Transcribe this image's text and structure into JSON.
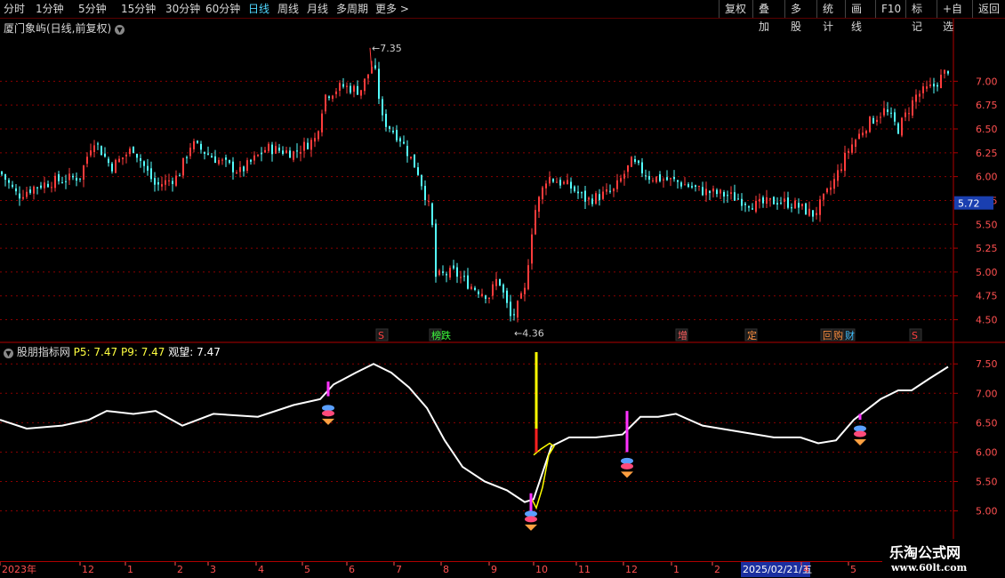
{
  "toolbar": {
    "periods": [
      "分时",
      "1分钟",
      "5分钟",
      "15分钟",
      "30分钟",
      "60分钟",
      "日线",
      "周线",
      "月线",
      "多周期",
      "更多"
    ],
    "active_period": "日线",
    "right_buttons": [
      "复权",
      "叠加",
      "多股",
      "统计",
      "画线",
      "F10",
      "标记",
      "+自选",
      "返回"
    ]
  },
  "stock": {
    "title": "厦门象屿(日线,前复权)",
    "current_price": "5.72",
    "high_label": "7.35",
    "low_label": "4.36"
  },
  "main_axis": {
    "ticks": [
      "7.00",
      "6.75",
      "6.50",
      "6.25",
      "6.00",
      "5.75",
      "5.50",
      "5.25",
      "5.00",
      "4.75",
      "4.50"
    ],
    "values": [
      7.0,
      6.75,
      6.5,
      6.25,
      6.0,
      5.75,
      5.5,
      5.25,
      5.0,
      4.75,
      4.5
    ],
    "range": [
      4.3,
      7.6
    ]
  },
  "markers": [
    {
      "text": "S",
      "color": "#ff4040"
    },
    {
      "text": "榜跌",
      "color": "#40ff40"
    },
    {
      "text": "增",
      "color": "#ff6060"
    },
    {
      "text": "定",
      "color": "#ff9040"
    },
    {
      "text": "回",
      "color": "#ff9040"
    },
    {
      "text": "购",
      "color": "#ff9040"
    },
    {
      "text": "财",
      "color": "#40c0ff"
    },
    {
      "text": "S",
      "color": "#ff4040"
    }
  ],
  "indicator": {
    "name": "股朋指标网",
    "p5_label": "P5:",
    "p5_value": "7.47",
    "p9_label": "P9:",
    "p9_value": "7.47",
    "watch_label": "观望:",
    "watch_value": "7.47",
    "ticks": [
      "7.50",
      "7.00",
      "6.50",
      "6.00",
      "5.50",
      "5.00"
    ],
    "values": [
      7.5,
      7.0,
      6.5,
      6.0,
      5.5,
      5.0
    ],
    "range": [
      4.6,
      7.7
    ]
  },
  "date_axis": {
    "labels": [
      "2023年",
      "12",
      "1",
      "2",
      "3",
      "4",
      "5",
      "6",
      "7",
      "8",
      "9",
      "10",
      "11",
      "12",
      "1",
      "2",
      "2025/02/21/五",
      "4",
      "5"
    ],
    "highlight": "2025/02/21/五"
  },
  "watermark": {
    "line1": "乐淘公式网",
    "line2": "www.60lt.com"
  },
  "colors": {
    "up": "#ff3c3c",
    "down": "#54ffff",
    "grid": "#8b0000",
    "accent": "#4fd7ff",
    "magenta": "#ff33ff",
    "yellow": "#ffff00"
  }
}
